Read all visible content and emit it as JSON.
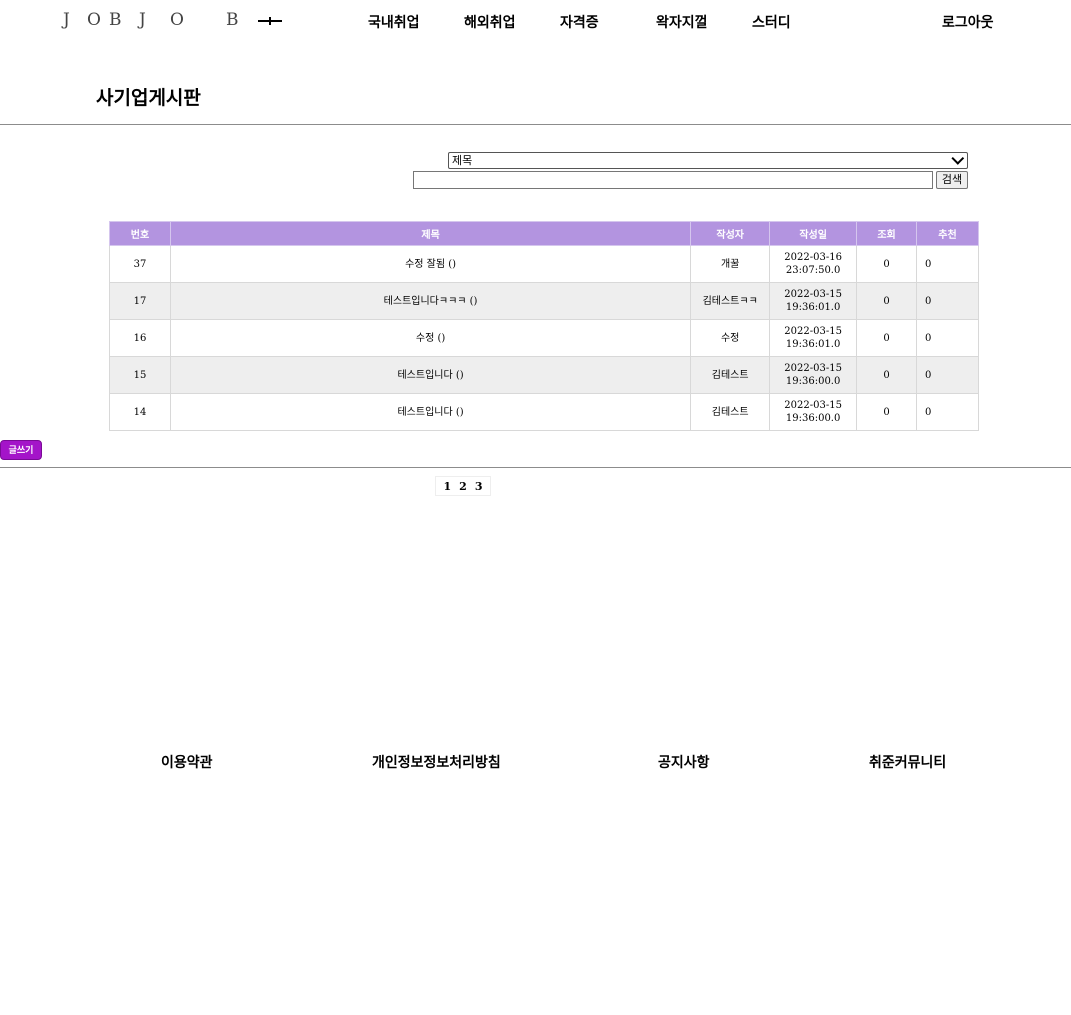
{
  "header": {
    "logo_letters": [
      "J",
      "O",
      "B",
      "J",
      "O",
      "B"
    ],
    "nav": [
      "국내취업",
      "해외취업",
      "자격증",
      "왁자지껄",
      "스터디"
    ],
    "logout": "로그아웃"
  },
  "page_title": "사기업게시판",
  "search": {
    "select_value": "제목",
    "input_value": "",
    "button_label": "검색"
  },
  "table": {
    "headers": [
      "번호",
      "제목",
      "작성자",
      "작성일",
      "조회",
      "추천"
    ],
    "rows": [
      {
        "no": "37",
        "title": "수정 잘됨 ()",
        "author": "개꿀",
        "date": "2022-03-16",
        "time": "23:07:50.0",
        "views": "0",
        "likes": "0"
      },
      {
        "no": "17",
        "title": "테스트입니다ㅋㅋㅋ ()",
        "author": "김테스트ㅋㅋ",
        "date": "2022-03-15",
        "time": "19:36:01.0",
        "views": "0",
        "likes": "0"
      },
      {
        "no": "16",
        "title": "수정 ()",
        "author": "수정",
        "date": "2022-03-15",
        "time": "19:36:01.0",
        "views": "0",
        "likes": "0"
      },
      {
        "no": "15",
        "title": "테스트입니다 ()",
        "author": "김테스트",
        "date": "2022-03-15",
        "time": "19:36:00.0",
        "views": "0",
        "likes": "0"
      },
      {
        "no": "14",
        "title": "테스트입니다 ()",
        "author": "김테스트",
        "date": "2022-03-15",
        "time": "19:36:00.0",
        "views": "0",
        "likes": "0"
      }
    ]
  },
  "write_button": "글쓰기",
  "pagination": [
    "1",
    "2",
    "3"
  ],
  "footer": [
    "이용약관",
    "개인정보정보처리방침",
    "공지사항",
    "취준커뮤니티"
  ],
  "colors": {
    "table_header": "#b394e0",
    "write_button": "#a414c9",
    "alt_row": "#eeeeee"
  }
}
